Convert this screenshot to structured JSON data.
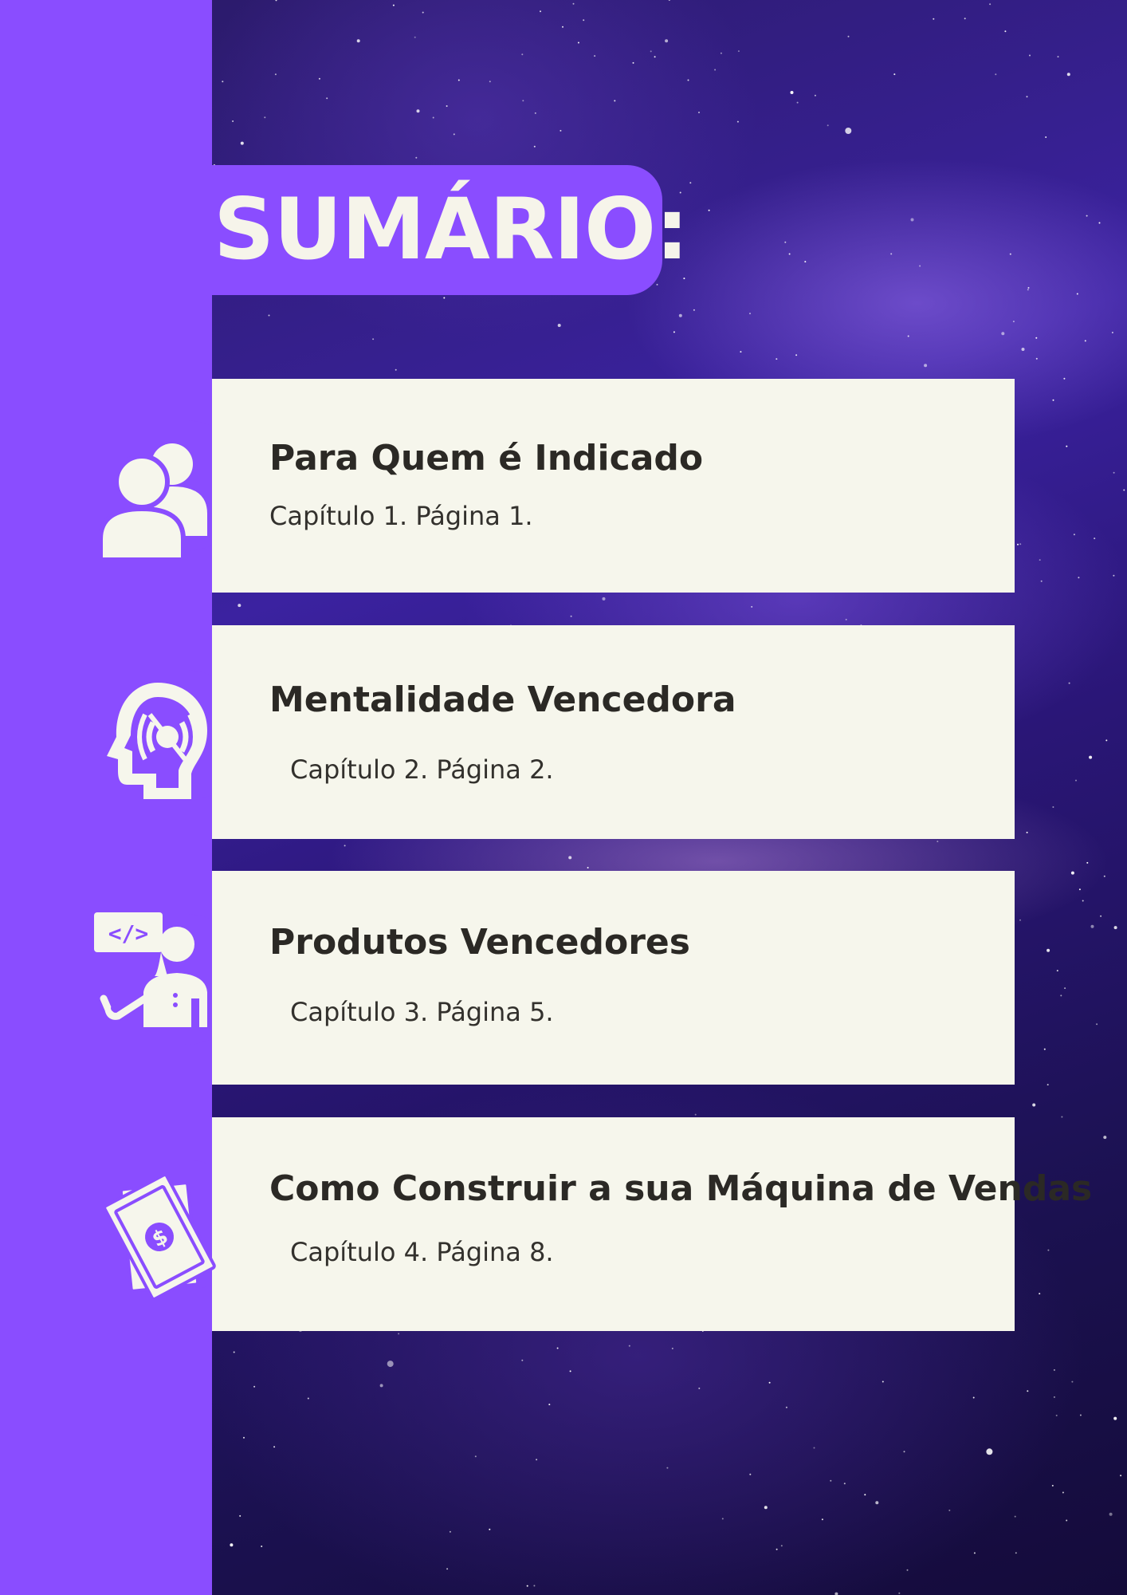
{
  "title": "SUMÁRIO:",
  "accent_color": "#8a4dff",
  "card_color": "#f6f6ec",
  "chapters": [
    {
      "title": "Para Quem é Indicado",
      "subtitle": "Capítulo 1. Página 1.",
      "icon": "users-icon"
    },
    {
      "title": "Mentalidade Vencedora",
      "subtitle": "Capítulo 2. Página 2.",
      "icon": "head-mind-icon"
    },
    {
      "title": "Produtos Vencedores",
      "subtitle": "Capítulo 3. Página 5.",
      "icon": "presenter-code-icon"
    },
    {
      "title": "Como Construir a sua Máquina de Vendas",
      "subtitle": "Capítulo 4. Página 8.",
      "icon": "money-bills-icon"
    }
  ]
}
